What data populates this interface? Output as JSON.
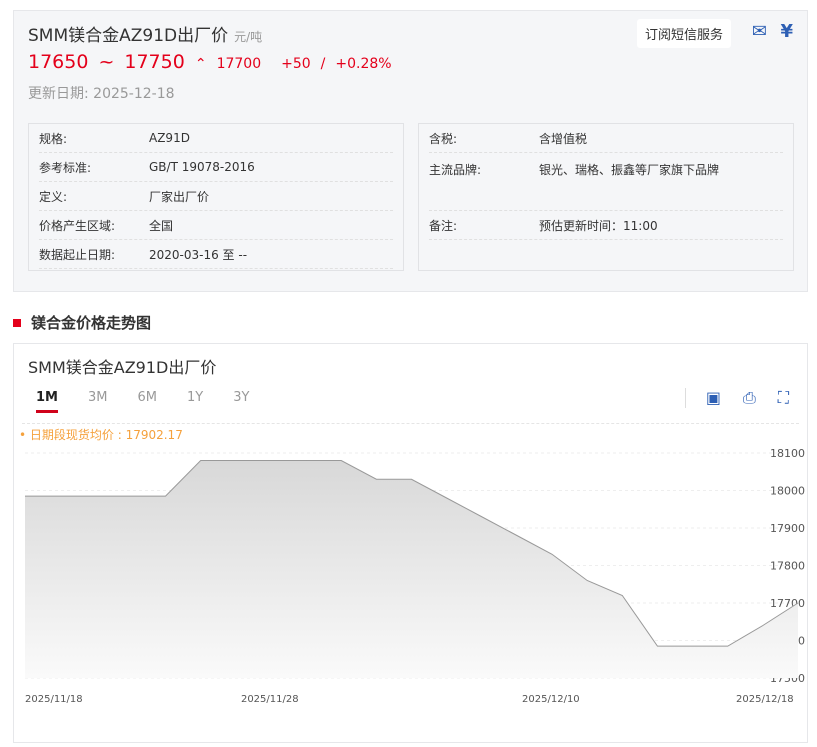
{
  "header": {
    "title": "SMM镁合金AZ91D出厂价",
    "unit": "元/吨",
    "low": "17650",
    "tilde": "~",
    "high": "17750",
    "avg": "17700",
    "change": "+50",
    "sep": "/",
    "pct": "+0.28%",
    "update_label": "更新日期:",
    "update_date": "2025-12-18",
    "subscribe": "订阅短信服务"
  },
  "left_info": [
    {
      "k": "规格:",
      "v": "AZ91D"
    },
    {
      "k": "参考标准:",
      "v": "GB/T 19078-2016"
    },
    {
      "k": "定义:",
      "v": "厂家出厂价"
    },
    {
      "k": "价格产生区域:",
      "v": "全国"
    },
    {
      "k": "数据起止日期:",
      "v": "2020-03-16 至 --"
    }
  ],
  "right_info": [
    {
      "k": "含税:",
      "v": "含增值税"
    },
    {
      "k": "主流品牌:",
      "v": "银光、瑞格、振鑫等厂家旗下品牌"
    },
    {
      "k": "备注:",
      "v": "预估更新时间：11:00"
    }
  ],
  "section_title": "镁合金价格走势图",
  "chart_title": "SMM镁合金AZ91D出厂价",
  "tabs": [
    "1M",
    "3M",
    "6M",
    "1Y",
    "3Y"
  ],
  "avg_label": "• 日期段现货均价 : 17902.17",
  "colors": {
    "red": "#e4001b",
    "blue": "#2d5fb4",
    "orange": "#f5a13c"
  },
  "chart_data": {
    "type": "area",
    "title": "SMM镁合金AZ91D出厂价",
    "ylim": [
      17500,
      18100
    ],
    "yticks": [
      "18100",
      "18000",
      "17900",
      "17800",
      "17700",
      "17600",
      "17500"
    ],
    "xlabels": [
      {
        "i": 0,
        "t": "2025/11/18"
      },
      {
        "i": 7,
        "t": "2025/11/28"
      },
      {
        "i": 15,
        "t": "2025/12/10"
      },
      {
        "i": 22,
        "t": "2025/12/18"
      }
    ],
    "values": [
      17985,
      17985,
      17985,
      17985,
      17985,
      18080,
      18080,
      18080,
      18080,
      18080,
      18030,
      18030,
      17980,
      17930,
      17880,
      17830,
      17760,
      17720,
      17585,
      17585,
      17585,
      17640,
      17700
    ]
  }
}
